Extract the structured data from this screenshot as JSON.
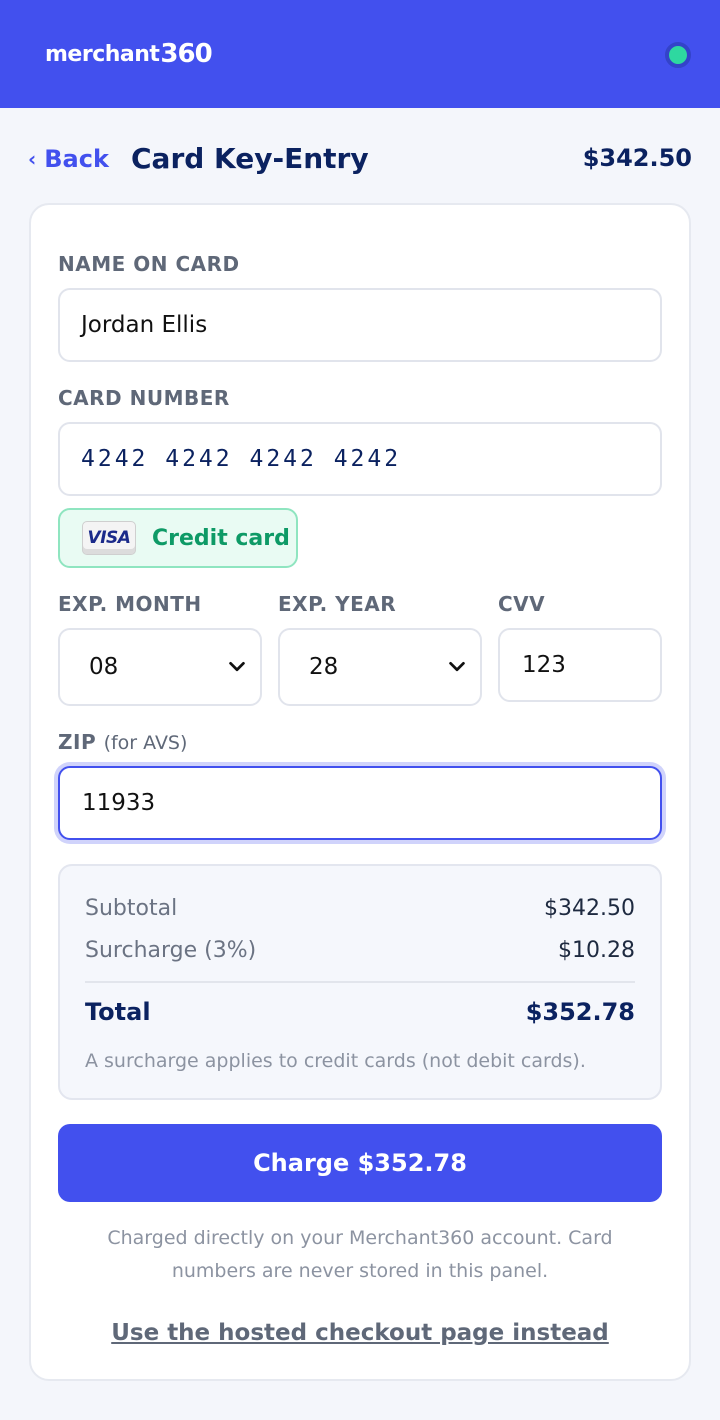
{
  "header": {
    "logo_text": "merchant",
    "logo_num": "360",
    "status_color": "#2ed8a0"
  },
  "nav": {
    "back_label": "Back",
    "title": "Card Key-Entry",
    "amount": "$342.50"
  },
  "form": {
    "name_label": "NAME ON CARD",
    "name_value": "Jordan Ellis",
    "card_label": "CARD NUMBER",
    "card_value": "4242 4242 4242 4242",
    "card_brand": "VISA",
    "card_type": "Credit card",
    "exp_month_label": "EXP. MONTH",
    "exp_month_value": "08",
    "exp_year_label": "EXP. YEAR",
    "exp_year_value": "28",
    "cvv_label": "CVV",
    "cvv_value": "123",
    "zip_label": "ZIP",
    "zip_sublabel": "(for AVS)",
    "zip_value": "11933"
  },
  "summary": {
    "subtotal_label": "Subtotal",
    "subtotal_value": "$342.50",
    "surcharge_label": "Surcharge (3%)",
    "surcharge_value": "$10.28",
    "total_label": "Total",
    "total_value": "$352.78",
    "note": "A surcharge applies to credit cards (not debit cards)."
  },
  "actions": {
    "charge_label": "Charge $352.78",
    "footer_note": "Charged directly on your Merchant360 account. Card numbers are never stored in this panel.",
    "hosted_link": "Use the hosted checkout page instead"
  },
  "colors": {
    "brand": "#4250ee",
    "success": "#0e9a66",
    "heading": "#0b2260"
  }
}
